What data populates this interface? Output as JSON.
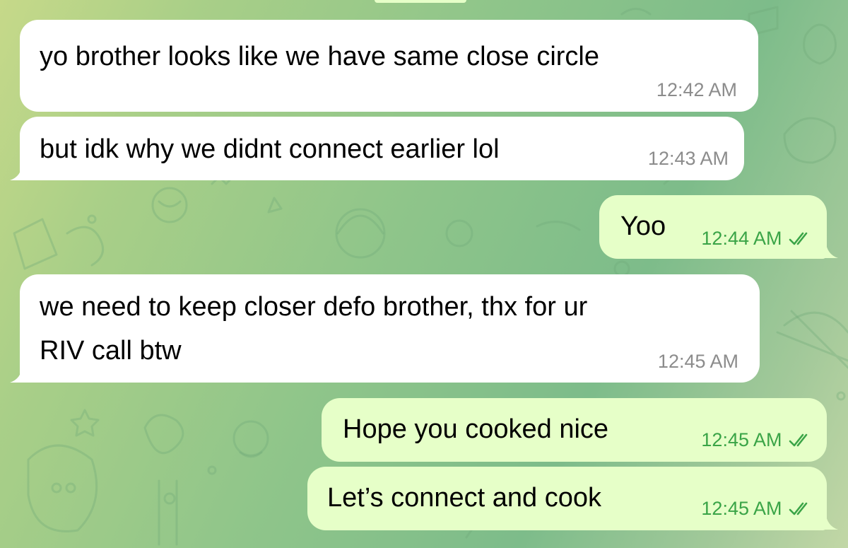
{
  "colors": {
    "incoming_bubble": "#ffffff",
    "outgoing_bubble": "#e6ffc8",
    "incoming_time": "#8c8c8c",
    "outgoing_time": "#3aa447",
    "read_checks": "#3aa447"
  },
  "messages": [
    {
      "direction": "incoming",
      "text": "yo brother looks like we have same close circle",
      "time": "12:42 AM"
    },
    {
      "direction": "incoming",
      "text": "but idk why we didnt connect earlier lol",
      "time": "12:43 AM"
    },
    {
      "direction": "outgoing",
      "text": "Yoo",
      "time": "12:44 AM",
      "status_icon": "double-check-read-icon"
    },
    {
      "direction": "incoming",
      "text_line1": "we need to keep closer defo brother, thx for ur",
      "text_line2": "RIV call btw",
      "time": "12:45 AM"
    },
    {
      "direction": "outgoing",
      "text": "Hope you cooked nice",
      "time": "12:45 AM",
      "status_icon": "double-check-read-icon"
    },
    {
      "direction": "outgoing",
      "text": "Let’s connect and cook",
      "time": "12:45 AM",
      "status_icon": "double-check-read-icon"
    }
  ]
}
